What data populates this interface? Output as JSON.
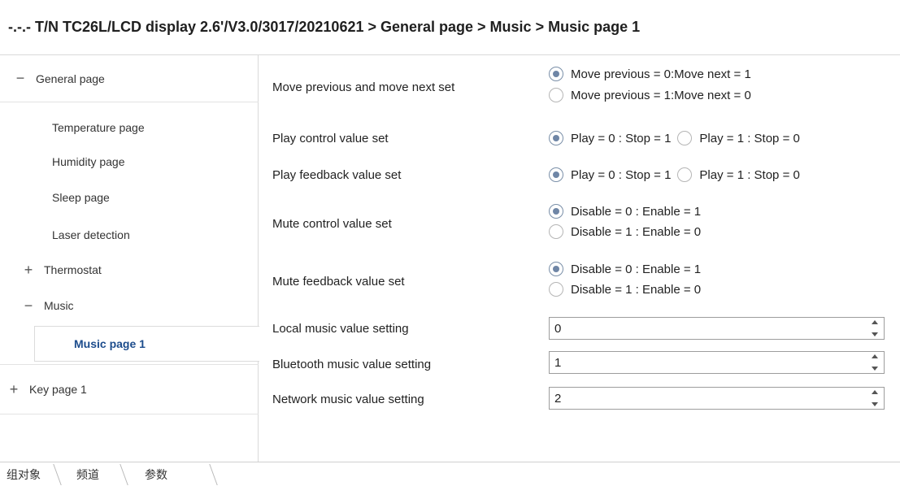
{
  "header": {
    "breadcrumb": "-.-.- T/N TC26L/LCD display 2.6'/V3.0/3017/20210621 > General page > Music > Music page 1"
  },
  "sidebar": {
    "items": [
      {
        "label": "General page",
        "expander": "−"
      },
      {
        "label": "Temperature page"
      },
      {
        "label": "Humidity page"
      },
      {
        "label": "Sleep page"
      },
      {
        "label": "Laser detection"
      },
      {
        "label": "Thermostat",
        "expander": "+"
      },
      {
        "label": "Music",
        "expander": "−"
      },
      {
        "label": "Music page 1",
        "selected": true
      },
      {
        "label": "Key page 1",
        "expander": "+"
      }
    ]
  },
  "params": {
    "move": {
      "label": "Move previous and move next set",
      "options": [
        "Move previous = 0:Move next = 1",
        "Move previous = 1:Move next = 0"
      ],
      "selected": 0
    },
    "play_control": {
      "label": "Play control value set",
      "options": [
        "Play = 0 : Stop = 1",
        "Play = 1 : Stop = 0"
      ],
      "selected": 0
    },
    "play_feedback": {
      "label": "Play feedback value set",
      "options": [
        "Play = 0 : Stop = 1",
        "Play = 1 : Stop = 0"
      ],
      "selected": 0
    },
    "mute_control": {
      "label": "Mute control value set",
      "options": [
        "Disable = 0 : Enable = 1",
        "Disable = 1 : Enable = 0"
      ],
      "selected": 0
    },
    "mute_feedback": {
      "label": "Mute feedback value set",
      "options": [
        "Disable = 0 : Enable = 1",
        "Disable = 1 : Enable = 0"
      ],
      "selected": 0
    },
    "local_music": {
      "label": "Local music value setting",
      "value": "0"
    },
    "bluetooth_music": {
      "label": "Bluetooth music value setting",
      "value": "1"
    },
    "network_music": {
      "label": "Network music value setting",
      "value": "2"
    }
  },
  "tabs": [
    "组对象",
    "频道",
    "参数"
  ],
  "colors": {
    "selected_text": "#1c4c8c",
    "radio_dot": "#6f86a6",
    "border": "#d9d9d9"
  }
}
